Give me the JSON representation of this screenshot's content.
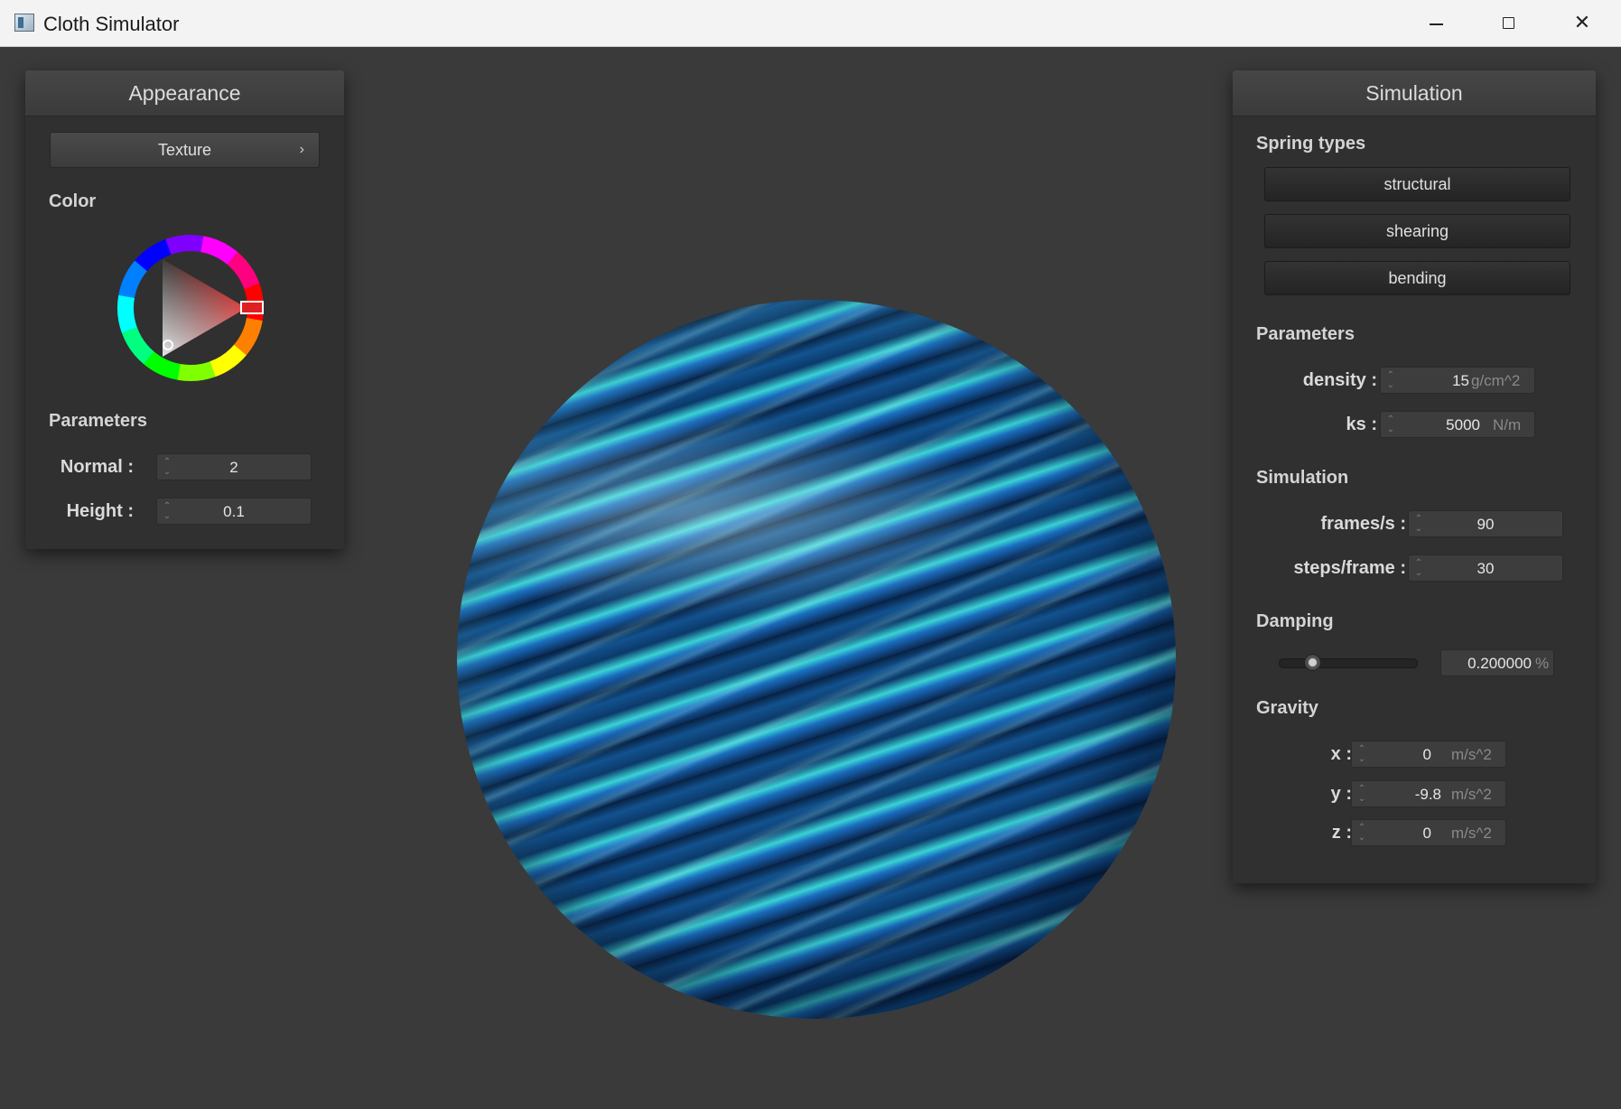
{
  "window": {
    "title": "Cloth Simulator",
    "minimize_glyph": "",
    "maximize_glyph": "",
    "close_glyph": "✕"
  },
  "appearance": {
    "header": "Appearance",
    "texture_button": "Texture",
    "texture_chevron": "›",
    "color_label": "Color",
    "parameters_label": "Parameters",
    "normal_label": "Normal :",
    "normal_value": "2",
    "height_label": "Height :",
    "height_value": "0.1",
    "color_hex": "#e02020"
  },
  "simulation": {
    "header": "Simulation",
    "spring_types_label": "Spring types",
    "spring_buttons": [
      "structural",
      "shearing",
      "bending"
    ],
    "parameters_label": "Parameters",
    "density_label": "density :",
    "density_value": "15",
    "density_unit": "g/cm^2",
    "ks_label": "ks :",
    "ks_value": "5000",
    "ks_unit": "N/m",
    "simulation_label": "Simulation",
    "fps_label": "frames/s :",
    "fps_value": "90",
    "steps_label": "steps/frame :",
    "steps_value": "30",
    "damping_label": "Damping",
    "damping_value": "0.200000",
    "damping_unit": "%",
    "damping_fraction": 0.2,
    "gravity_label": "Gravity",
    "gx_label": "x :",
    "gx_value": "0",
    "gy_label": "y :",
    "gy_value": "-9.8",
    "gz_label": "z :",
    "gz_value": "0",
    "g_unit": "m/s^2"
  },
  "colors": {
    "background": "#3a3a3a",
    "panel": "#303030",
    "selected_color": "#e02020"
  }
}
